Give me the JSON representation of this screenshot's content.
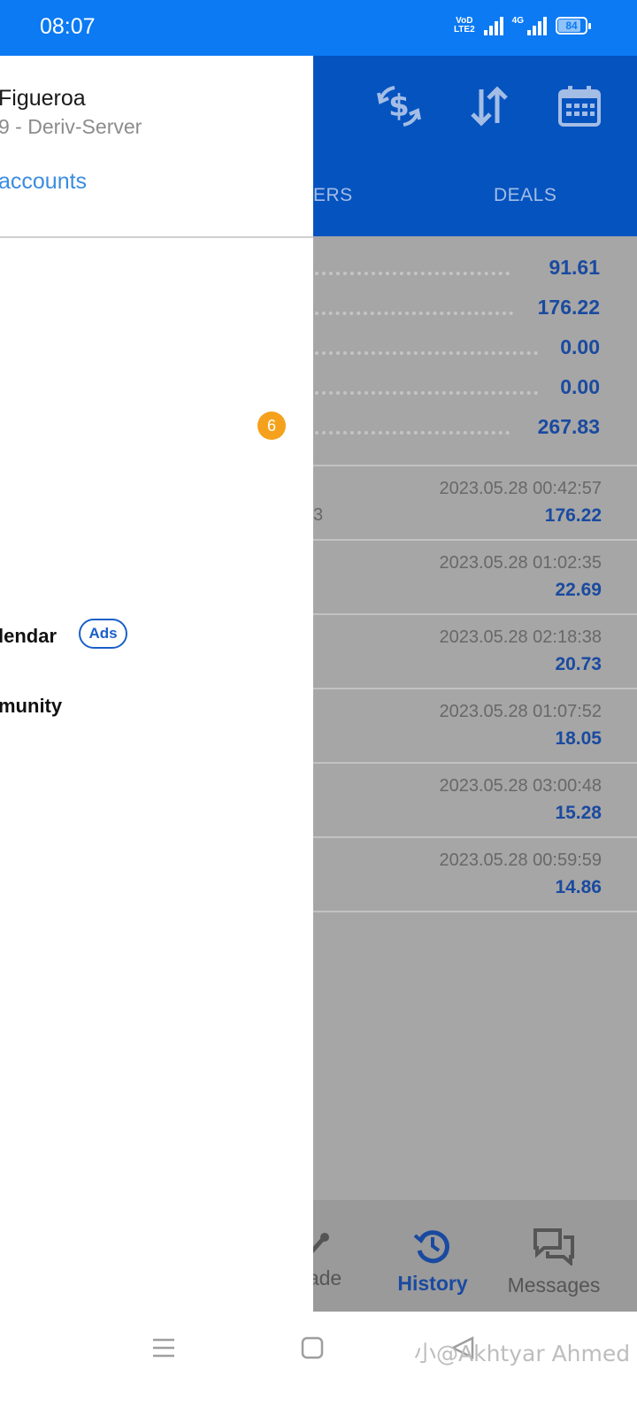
{
  "status_bar": {
    "time": "08:07",
    "volte_top": "VoD",
    "volte_bottom": "LTE2",
    "network_type": "4G",
    "battery_level": "84",
    "battery_fraction": 0.84
  },
  "toolbar": {
    "icons": [
      "currency-exchange-icon",
      "sort-arrows-icon",
      "calendar-icon"
    ]
  },
  "tabs": {
    "orders_clipped": "ERS",
    "deals": "DEALS"
  },
  "summary": {
    "values": [
      "91.61",
      "176.22",
      "0.00",
      "0.00",
      "267.83"
    ]
  },
  "deals": [
    {
      "datetime": "2023.05.28 00:42:57",
      "amount": "176.22",
      "clipped": "3"
    },
    {
      "datetime": "2023.05.28 01:02:35",
      "amount": "22.69",
      "clipped": ""
    },
    {
      "datetime": "2023.05.28 02:18:38",
      "amount": "20.73",
      "clipped": ""
    },
    {
      "datetime": "2023.05.28 01:07:52",
      "amount": "18.05",
      "clipped": ""
    },
    {
      "datetime": "2023.05.28 03:00:48",
      "amount": "15.28",
      "clipped": ""
    },
    {
      "datetime": "2023.05.28 00:59:59",
      "amount": "14.86",
      "clipped": ""
    }
  ],
  "bottom_nav": {
    "trade_clipped": "ade",
    "history": "History",
    "messages": "Messages"
  },
  "drawer": {
    "account_name": "Figueroa",
    "server": "9 - Deriv-Server",
    "manage_accounts": "accounts",
    "badge_count": "6",
    "menu_calendar": "lendar",
    "ads_label": "Ads",
    "menu_community": "munity"
  },
  "watermark": "小@Akhtyar Ahmed",
  "colors": {
    "status_bar": "#0b7af3",
    "toolbar": "#0553bf",
    "accent_value": "#1a4aa0",
    "badge": "#f5a11c",
    "link": "#3a8ce0"
  }
}
